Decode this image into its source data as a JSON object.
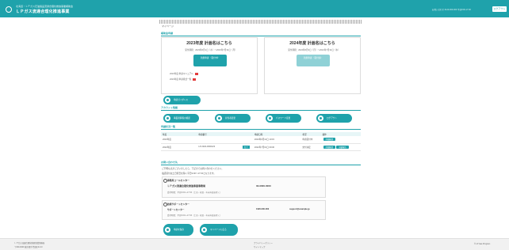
{
  "header": {
    "subtitle": "北海道・ＬＰガス石油製品流通合理化推進事業補助金",
    "title": "ＬＰガス流通合理化推進事業",
    "info": "お問い合わせ 0120-000-000 平日9:00-17:00",
    "login_label": "ログアウト"
  },
  "page": {
    "title": "マイページ",
    "section_apply": "補助金申請",
    "section_menu": "アカウント情報",
    "section_requests": "申請状況一覧",
    "section_contact": "お問い合わせ先"
  },
  "cards": [
    {
      "title": "2023年度 計画名はこちら",
      "period": "受付期間：2023年6月1日（木）〜2023年7月31日（月）",
      "button": "新規申請\n（受付中）",
      "note1": "2023年度 申請マニュアル",
      "note2": "2023年度 申請様式一覧"
    },
    {
      "title": "2024年度 計画名はこちら",
      "period": "受付期間：2024年6月3日（月）〜2024年7月31日（水）",
      "button": "新規申請\n（受付前）"
    }
  ],
  "menu_small": "申請ガイダンス",
  "menu": [
    "事業者情報の確認",
    "担当者変更",
    "パスワード変更",
    "ログアウト"
  ],
  "table": {
    "headers": [
      "年度",
      "申請番号",
      "",
      "申請日時",
      "状況",
      "操作"
    ],
    "rows": [
      {
        "year": "2023年度",
        "number": "",
        "tag": "",
        "date": "2023年6月12日 10:15",
        "status": "申請受付中",
        "actions": [
          "詳細確認"
        ]
      },
      {
        "year": "2022年度",
        "number": "LP-2022-0000123",
        "tag": "完了",
        "date": "2022年7月01日 09:30",
        "status": "交付決定",
        "actions": [
          "詳細確認",
          "実績報告"
        ]
      }
    ]
  },
  "contact": {
    "intro1": "ご不明な点がございましたら、下記までお問い合わせください。",
    "intro2": "電話受付は土日祝日を除く平日9:00〜17:00となります。",
    "box1": {
      "title": "事務局コールセンター",
      "name": "ＬＰガス流通合理化推進事業事務局",
      "tel": "03-0000-0000",
      "note": "受付時間：平日9:00〜17:00（土日・祝日・年末年始を除く）"
    },
    "box2": {
      "title": "技術サポートセンター",
      "name": "サポートセンター",
      "tel": "0120-000-000",
      "mail": "support@example.jp",
      "note": "受付時間：平日9:00〜17:00（土日・祝日・年末年始を除く）"
    }
  },
  "bottom_buttons": [
    "申請を保存",
    "マイページに戻る"
  ],
  "footer": {
    "left1": "ＬＰガス流通合理化推進事業事務局",
    "left2": "〒000-0000 東京都千代田区0-0-0",
    "mid": "プライバシーポリシー",
    "mid2": "サイトマップ",
    "right": "© LP Gas Program"
  }
}
